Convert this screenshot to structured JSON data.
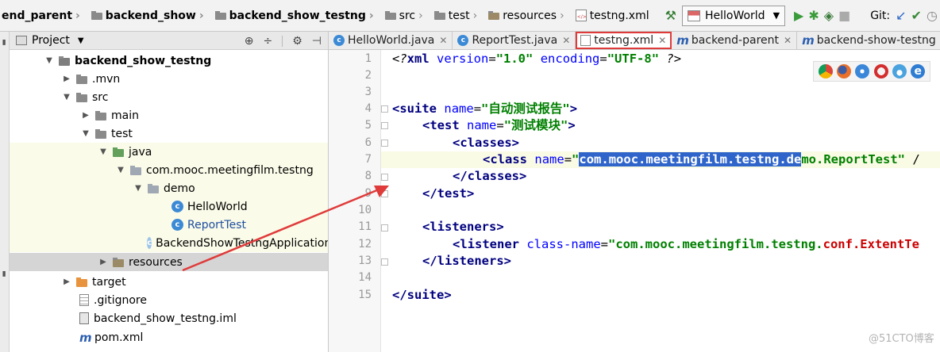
{
  "breadcrumbs": [
    {
      "label": "end_parent",
      "bold": true
    },
    {
      "label": "backend_show",
      "bold": true
    },
    {
      "label": "backend_show_testng",
      "bold": true
    },
    {
      "label": "src",
      "bold": false
    },
    {
      "label": "test",
      "bold": false
    },
    {
      "label": "resources",
      "bold": false
    },
    {
      "label": "testng.xml",
      "bold": false
    }
  ],
  "toolbar": {
    "run_config": "HelloWorld",
    "git_label": "Git:"
  },
  "project_panel": {
    "title": "Project",
    "tree": [
      {
        "label": "backend_show_testng",
        "bold": true
      },
      {
        "label": ".mvn"
      },
      {
        "label": "src"
      },
      {
        "label": "main"
      },
      {
        "label": "test"
      },
      {
        "label": "java"
      },
      {
        "label": "com.mooc.meetingfilm.testng"
      },
      {
        "label": "demo"
      },
      {
        "label": "HelloWorld"
      },
      {
        "label": "ReportTest"
      },
      {
        "label": "BackendShowTestngApplicationT"
      },
      {
        "label": "resources"
      },
      {
        "label": "target"
      },
      {
        "label": ".gitignore"
      },
      {
        "label": "backend_show_testng.iml"
      },
      {
        "label": "pom.xml"
      }
    ]
  },
  "editor_tabs": [
    {
      "label": "HelloWorld.java",
      "icon": "class-icon",
      "active": false
    },
    {
      "label": "ReportTest.java",
      "icon": "class-icon",
      "active": false
    },
    {
      "label": "testng.xml",
      "icon": "xml-file-icon",
      "active": true
    },
    {
      "label": "backend-parent",
      "icon": "maven-icon",
      "active": false
    },
    {
      "label": "backend-show-testng",
      "icon": "maven-icon",
      "active": false
    }
  ],
  "editor": {
    "line_numbers": [
      "1",
      "2",
      "3",
      "4",
      "5",
      "6",
      "7",
      "8",
      "9",
      "10",
      "11",
      "12",
      "13",
      "14",
      "15"
    ],
    "code": {
      "l1": {
        "open": "<?",
        "tag": "xml",
        "a1": "version",
        "v1": "\"1.0\"",
        "a2": "encoding",
        "v2": "\"UTF-8\"",
        "close": "?>"
      },
      "l4": {
        "open": "<",
        "tag": "suite",
        "attr": "name",
        "eq": "=",
        "value": "\"自动测试报告\"",
        "close": ">"
      },
      "l5": {
        "open": "<",
        "tag": "test",
        "attr": "name",
        "eq": "=",
        "value": "\"测试模块\"",
        "close": ">"
      },
      "l6": {
        "open": "<",
        "tag": "classes",
        "close": ">"
      },
      "l7": {
        "open": "<",
        "tag": "class",
        "attr": "name",
        "eq": "=",
        "quote": "\"",
        "selected": "com.mooc.meetingfilm.testng.de",
        "rest": "mo.ReportTest\"",
        "tail": " /"
      },
      "l8": {
        "open": "</",
        "tag": "classes",
        "close": ">"
      },
      "l9": {
        "open": "</",
        "tag": "test",
        "close": ">"
      },
      "l11": {
        "open": "<",
        "tag": "listeners",
        "close": ">"
      },
      "l12": {
        "open": "<",
        "tag": "listener",
        "attr": "class-name",
        "eq": "=",
        "v_part1": "\"com.mooc.meetingfilm.testng.",
        "v_part2": "conf.ExtentTe"
      },
      "l13": {
        "open": "</",
        "tag": "listeners",
        "close": ">"
      },
      "l15": {
        "open": "</",
        "tag": "suite",
        "close": ">"
      }
    }
  },
  "watermark": "@51CTO博客",
  "colors": {
    "xml_tag": "#000080",
    "xml_attr": "#0000ff",
    "xml_value": "#008000",
    "selection": "#2f65ca",
    "annotation_red": "#e03b3b"
  }
}
